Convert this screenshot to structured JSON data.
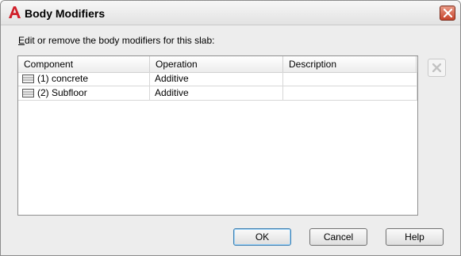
{
  "window": {
    "title": "Body Modifiers",
    "app_icon": "autocad-a-icon",
    "close_icon": "close-icon"
  },
  "instruction": {
    "mnemonic": "E",
    "rest": "dit or remove the body modifiers for this slab:"
  },
  "table": {
    "columns": [
      "Component",
      "Operation",
      "Description"
    ],
    "rows": [
      {
        "icon": "component-layer-icon",
        "component": "(1) concrete",
        "operation": "Additive",
        "description": ""
      },
      {
        "icon": "component-layer-icon",
        "component": "(2) Subfloor",
        "operation": "Additive",
        "description": ""
      }
    ]
  },
  "side_buttons": {
    "delete_icon": "delete-x-icon"
  },
  "buttons": {
    "ok": "OK",
    "cancel": "Cancel",
    "help": "Help"
  },
  "colors": {
    "close_button": "#c7432b",
    "default_button_border": "#3c7fb1"
  }
}
